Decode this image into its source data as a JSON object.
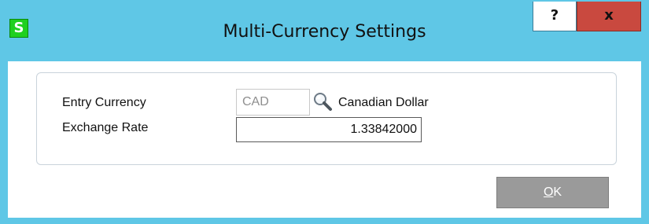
{
  "window": {
    "title": "Multi-Currency Settings",
    "app_icon_letter": "S",
    "help_label": "?",
    "close_label": "x"
  },
  "form": {
    "entry_currency_label": "Entry Currency",
    "entry_currency_code": "CAD",
    "entry_currency_name": "Canadian Dollar",
    "exchange_rate_label": "Exchange Rate",
    "exchange_rate_value": "1.33842000"
  },
  "buttons": {
    "ok_mnemonic": "O",
    "ok_rest": "K"
  },
  "colors": {
    "titlebar": "#5fc7e6",
    "close_button": "#c9493f",
    "app_icon": "#1fd01f",
    "ok_button": "#9a9a9a"
  },
  "icons": {
    "lookup": "magnifier-icon"
  }
}
